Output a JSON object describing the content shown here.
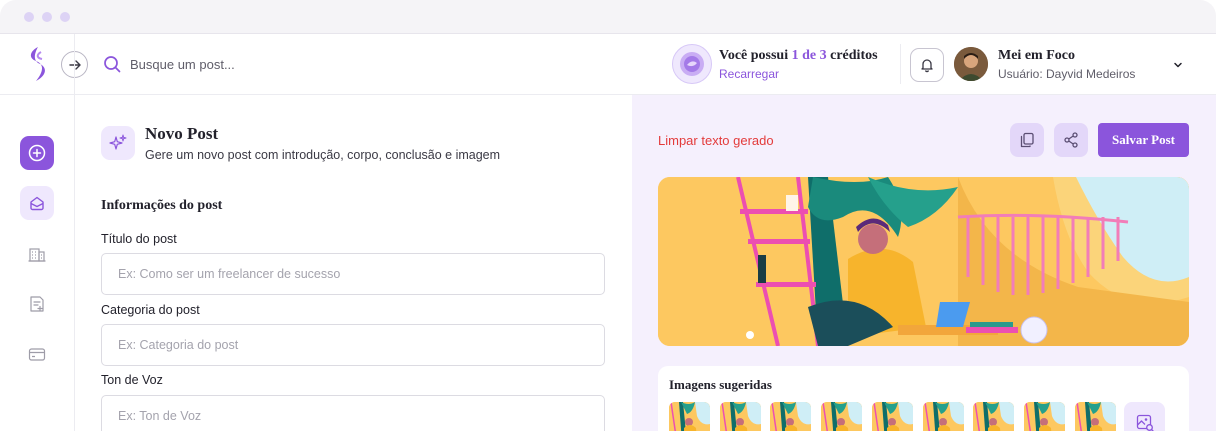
{
  "search": {
    "placeholder": "Busque um post..."
  },
  "credits": {
    "prefix": "Você possui ",
    "count": "1 de 3",
    "suffix": " créditos",
    "recharge_label": "Recarregar"
  },
  "user": {
    "name": "Mei em Foco",
    "subtitle": "Usuário: Dayvid Medeiros"
  },
  "sidebar": {
    "items": [
      {
        "icon": "plus-circle-icon"
      },
      {
        "icon": "inbox-icon"
      },
      {
        "icon": "building-icon"
      },
      {
        "icon": "document-add-icon"
      },
      {
        "icon": "card-icon"
      }
    ]
  },
  "main": {
    "title": "Novo Post",
    "subtitle": "Gere um novo post com introdução, corpo, conclusão e imagem",
    "section_title": "Informações do post",
    "fields": [
      {
        "label": "Título do post",
        "placeholder": "Ex: Como ser um freelancer de sucesso"
      },
      {
        "label": "Categoria do post",
        "placeholder": "Ex: Categoria do post"
      },
      {
        "label": "Ton de Voz",
        "placeholder": "Ex: Ton de Voz"
      }
    ]
  },
  "preview": {
    "clear_label": "Limpar texto gerado",
    "save_label": "Salvar Post",
    "suggested_title": "Imagens sugeridas"
  },
  "colors": {
    "accent": "#8b55dc",
    "accent_light": "#efe8fd",
    "danger": "#e33b3b",
    "panel_bg": "#f5f0fd"
  }
}
